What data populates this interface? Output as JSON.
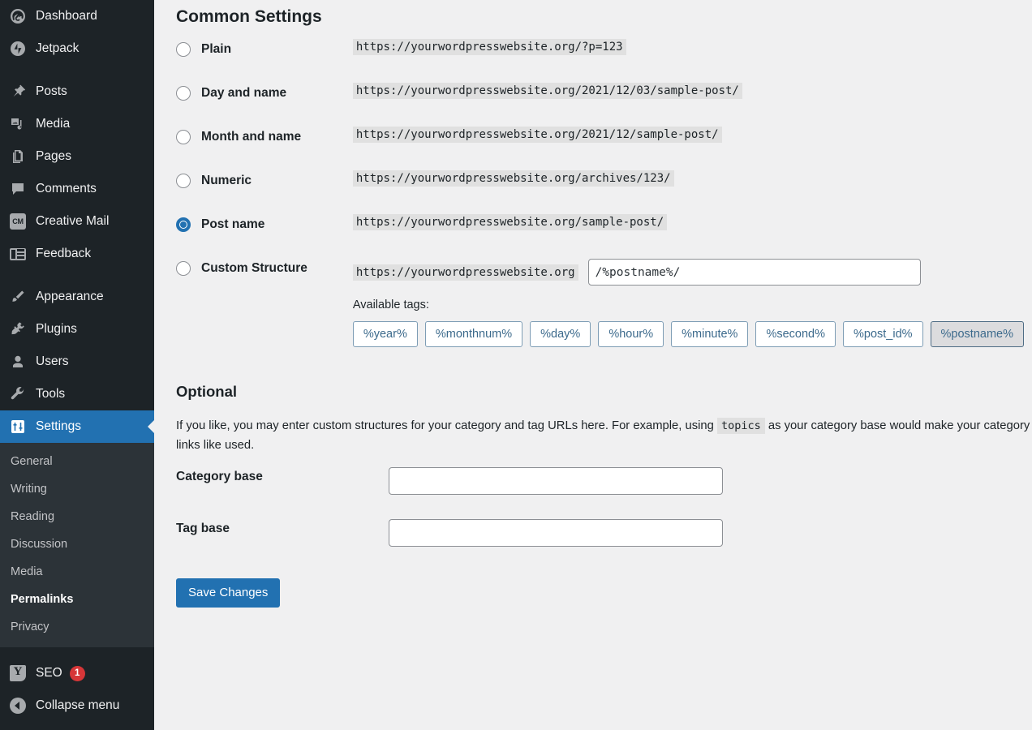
{
  "sidebar": {
    "items": [
      {
        "label": "Dashboard",
        "icon": "dashboard-icon",
        "name": "dashboard"
      },
      {
        "label": "Jetpack",
        "icon": "jetpack-icon",
        "name": "jetpack"
      },
      {
        "label": "Posts",
        "icon": "pin-icon",
        "name": "posts"
      },
      {
        "label": "Media",
        "icon": "media-icon",
        "name": "media"
      },
      {
        "label": "Pages",
        "icon": "pages-icon",
        "name": "pages"
      },
      {
        "label": "Comments",
        "icon": "comment-icon",
        "name": "comments"
      },
      {
        "label": "Creative Mail",
        "icon": "creative-mail-icon",
        "name": "creative-mail"
      },
      {
        "label": "Feedback",
        "icon": "feedback-icon",
        "name": "feedback"
      },
      {
        "label": "Appearance",
        "icon": "brush-icon",
        "name": "appearance"
      },
      {
        "label": "Plugins",
        "icon": "plug-icon",
        "name": "plugins"
      },
      {
        "label": "Users",
        "icon": "user-icon",
        "name": "users"
      },
      {
        "label": "Tools",
        "icon": "wrench-icon",
        "name": "tools"
      },
      {
        "label": "Settings",
        "icon": "settings-icon",
        "name": "settings"
      }
    ],
    "submenu": [
      {
        "label": "General"
      },
      {
        "label": "Writing"
      },
      {
        "label": "Reading"
      },
      {
        "label": "Discussion"
      },
      {
        "label": "Media"
      },
      {
        "label": "Permalinks"
      },
      {
        "label": "Privacy"
      }
    ],
    "seo": {
      "label": "SEO",
      "badge": "1",
      "icon": "yoast-icon"
    },
    "collapse": {
      "label": "Collapse menu",
      "icon": "collapse-icon"
    },
    "colors": {
      "background": "#1d2327",
      "submenu_background": "#2c3338",
      "active": "#2271b1",
      "badge": "#d63638"
    }
  },
  "main": {
    "common_settings_title": "Common Settings",
    "permalink_options": [
      {
        "label": "Plain",
        "url": "https://yourwordpresswebsite.org/?p=123",
        "selected": false
      },
      {
        "label": "Day and name",
        "url": "https://yourwordpresswebsite.org/2021/12/03/sample-post/",
        "selected": false
      },
      {
        "label": "Month and name",
        "url": "https://yourwordpresswebsite.org/2021/12/sample-post/",
        "selected": false
      },
      {
        "label": "Numeric",
        "url": "https://yourwordpresswebsite.org/archives/123/",
        "selected": false
      },
      {
        "label": "Post name",
        "url": "https://yourwordpresswebsite.org/sample-post/",
        "selected": true
      }
    ],
    "custom_structure": {
      "label": "Custom Structure",
      "selected": false,
      "prefix": "https://yourwordpresswebsite.org",
      "value": "/%postname%/",
      "placeholder": ""
    },
    "available_tags_label": "Available tags:",
    "available_tags": [
      {
        "label": "%year%",
        "hovered": false
      },
      {
        "label": "%monthnum%",
        "hovered": false
      },
      {
        "label": "%day%",
        "hovered": false
      },
      {
        "label": "%hour%",
        "hovered": false
      },
      {
        "label": "%minute%",
        "hovered": false
      },
      {
        "label": "%second%",
        "hovered": false
      },
      {
        "label": "%post_id%",
        "hovered": false
      },
      {
        "label": "%postname%",
        "hovered": true
      }
    ],
    "optional_title": "Optional",
    "optional_desc_part1": "If you like, you may enter custom structures for your category and tag URLs here. For example, using ",
    "optional_desc_code": "topics",
    "optional_desc_part2": " as your category base would make your category links like ",
    "optional_desc_part3": "used.",
    "category_base": {
      "label": "Category base",
      "value": "",
      "placeholder": ""
    },
    "tag_base": {
      "label": "Tag base",
      "value": "",
      "placeholder": ""
    },
    "save_label": "Save Changes",
    "colors": {
      "background": "#f0f0f1",
      "code_background": "#e0e0e0",
      "button": "#2271b1",
      "tag_border": "#7e9db5",
      "tag_text": "#3c6a8c"
    }
  }
}
